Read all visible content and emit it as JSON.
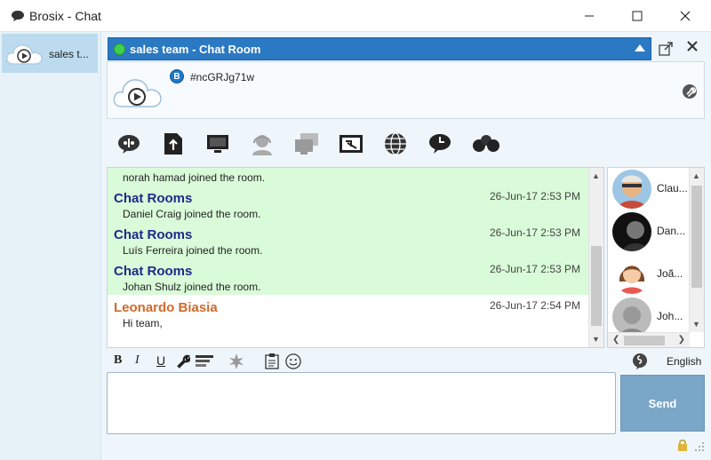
{
  "window": {
    "title": "Brosix - Chat"
  },
  "sidebar": {
    "items": [
      {
        "label": "sales t..."
      }
    ]
  },
  "room": {
    "name": "sales team - Chat Room",
    "code": "#ncGRJg71w",
    "badge": "B"
  },
  "toolbar": {
    "icons": [
      "whiteboard-icon",
      "file-upload-icon",
      "screen-share-icon",
      "voice-call-icon",
      "remote-desktop-icon",
      "screenshot-icon",
      "web-icon",
      "history-icon",
      "members-icon"
    ]
  },
  "messages": [
    {
      "type": "system",
      "sender": "",
      "time": "",
      "text": "norah hamad joined the room."
    },
    {
      "type": "system",
      "sender": "Chat Rooms",
      "time": "26-Jun-17 2:53 PM",
      "text": "Daniel Craig joined the room."
    },
    {
      "type": "system",
      "sender": "Chat Rooms",
      "time": "26-Jun-17 2:53 PM",
      "text": "Luís Ferreira joined the room."
    },
    {
      "type": "system",
      "sender": "Chat Rooms",
      "time": "26-Jun-17 2:53 PM",
      "text": "Johan Shulz joined the room."
    },
    {
      "type": "user",
      "sender": "Leonardo Biasia",
      "time": "26-Jun-17 2:54 PM",
      "text": "Hi team,"
    }
  ],
  "participants": [
    {
      "name": "Clau..."
    },
    {
      "name": "Dan..."
    },
    {
      "name": "Joã..."
    },
    {
      "name": "Joh..."
    }
  ],
  "format": {
    "bold": "B",
    "italic": "I",
    "underline": "U",
    "language": "English"
  },
  "compose": {
    "placeholder": "",
    "value": ""
  },
  "send": {
    "label": "Send"
  },
  "colors": {
    "header": "#2b79c2",
    "system_bg": "#d9fbd9",
    "sender_system": "#1e2a8a",
    "sender_user": "#d06a2a",
    "send_bg": "#7aa6c8"
  }
}
